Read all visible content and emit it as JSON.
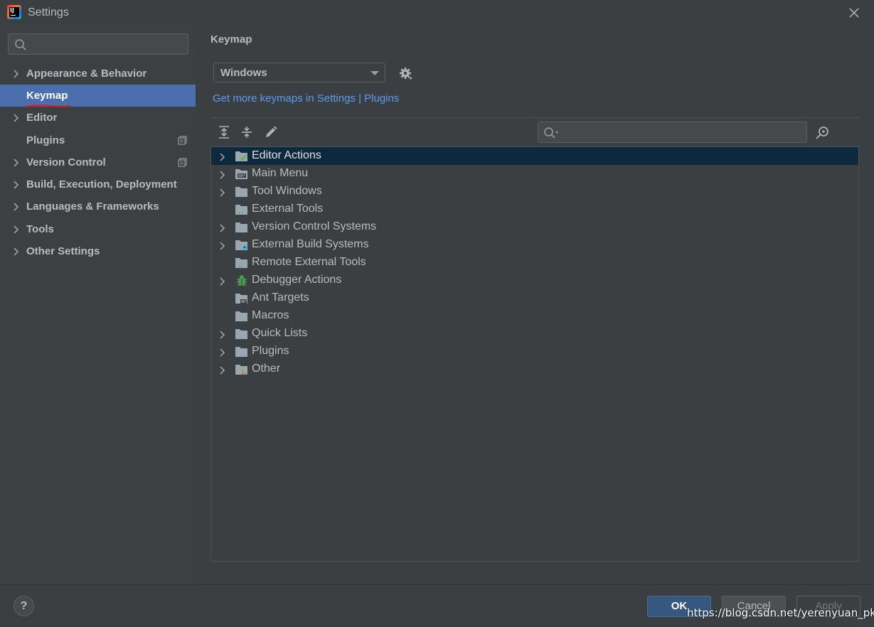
{
  "window": {
    "title": "Settings",
    "app_icon_text": "IJ"
  },
  "sidebar": {
    "search": {
      "placeholder": "",
      "value": ""
    },
    "items": [
      {
        "label": "Appearance & Behavior",
        "expandable": true,
        "selected": false,
        "project_icon": false
      },
      {
        "label": "Keymap",
        "expandable": false,
        "selected": true,
        "project_icon": false
      },
      {
        "label": "Editor",
        "expandable": true,
        "selected": false,
        "project_icon": false
      },
      {
        "label": "Plugins",
        "expandable": false,
        "selected": false,
        "project_icon": true
      },
      {
        "label": "Version Control",
        "expandable": true,
        "selected": false,
        "project_icon": true
      },
      {
        "label": "Build, Execution, Deployment",
        "expandable": true,
        "selected": false,
        "project_icon": false
      },
      {
        "label": "Languages & Frameworks",
        "expandable": true,
        "selected": false,
        "project_icon": false
      },
      {
        "label": "Tools",
        "expandable": true,
        "selected": false,
        "project_icon": false
      },
      {
        "label": "Other Settings",
        "expandable": true,
        "selected": false,
        "project_icon": false
      }
    ]
  },
  "main": {
    "title": "Keymap",
    "keymap_select": {
      "value": "Windows"
    },
    "plugins_link": "Get more keymaps in Settings | Plugins",
    "toolbar": [
      "expand-all-icon",
      "collapse-all-icon",
      "edit-icon"
    ],
    "tree_search": {
      "placeholder": "",
      "value": ""
    },
    "tree": [
      {
        "label": "Editor Actions",
        "expandable": true,
        "selected": true,
        "icon": "editor-actions-icon"
      },
      {
        "label": "Main Menu",
        "expandable": true,
        "selected": false,
        "icon": "main-menu-icon"
      },
      {
        "label": "Tool Windows",
        "expandable": true,
        "selected": false,
        "icon": "folder-icon"
      },
      {
        "label": "External Tools",
        "expandable": false,
        "selected": false,
        "icon": "external-tools-icon"
      },
      {
        "label": "Version Control Systems",
        "expandable": true,
        "selected": false,
        "icon": "folder-icon"
      },
      {
        "label": "External Build Systems",
        "expandable": true,
        "selected": false,
        "icon": "build-systems-icon"
      },
      {
        "label": "Remote External Tools",
        "expandable": false,
        "selected": false,
        "icon": "external-tools-icon"
      },
      {
        "label": "Debugger Actions",
        "expandable": true,
        "selected": false,
        "icon": "bug-icon"
      },
      {
        "label": "Ant Targets",
        "expandable": false,
        "selected": false,
        "icon": "ant-icon"
      },
      {
        "label": "Macros",
        "expandable": false,
        "selected": false,
        "icon": "folder-icon"
      },
      {
        "label": "Quick Lists",
        "expandable": true,
        "selected": false,
        "icon": "folder-icon"
      },
      {
        "label": "Plugins",
        "expandable": true,
        "selected": false,
        "icon": "folder-icon"
      },
      {
        "label": "Other",
        "expandable": true,
        "selected": false,
        "icon": "other-icon"
      }
    ]
  },
  "footer": {
    "help_label": "?",
    "ok_label": "OK",
    "cancel_label": "Cancel",
    "apply_label": "Apply"
  },
  "watermark": "https://blog.csdn.net/yerenyuan_pku",
  "colors": {
    "background": "#3c3f41",
    "selection": "#4b6eaf",
    "tree_selection": "#0d293e",
    "link": "#589df6",
    "ok_button": "#365880",
    "annotation_underline": "#e0181a"
  }
}
